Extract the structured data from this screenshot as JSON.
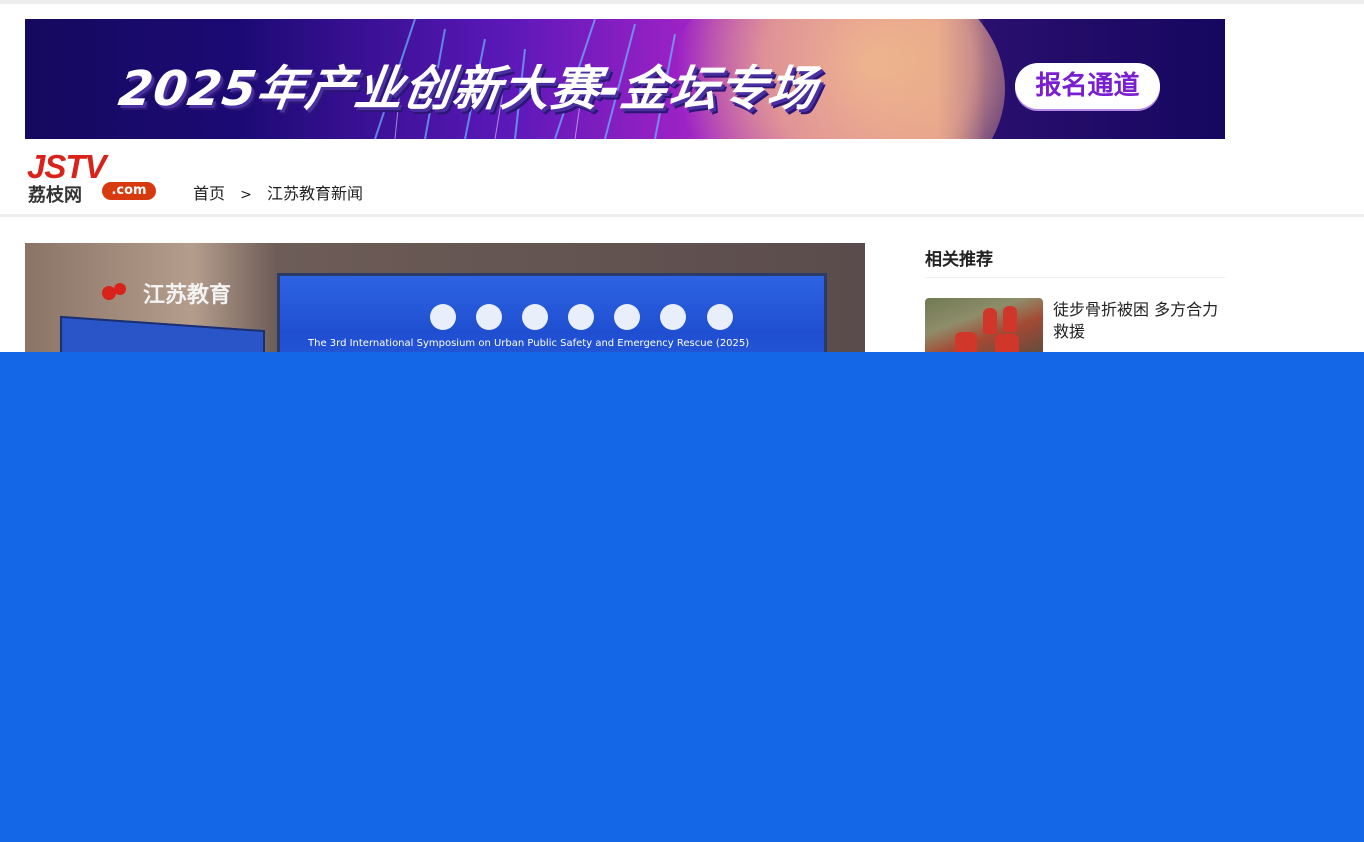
{
  "banner": {
    "title": "2025年产业创新大赛-金坛专场",
    "cta_label": "报名通道"
  },
  "logo": {
    "primary": "JSTV",
    "secondary": "荔枝网",
    "suffix": ".com"
  },
  "breadcrumb": {
    "home": "首页",
    "separator": ">",
    "current": "江苏教育新闻"
  },
  "hero": {
    "brand_text": "江苏教育",
    "screen_caption": "The 3rd International Symposium on Urban Public Safety and Emergency Rescue (2025)"
  },
  "sidebar": {
    "title": "相关推荐",
    "items": [
      {
        "title": "徒步骨折被困 多方合力救援"
      }
    ]
  },
  "colors": {
    "overlay": "#1467e6",
    "brand_red": "#d8231b",
    "cta_text": "#7a1fd0"
  }
}
